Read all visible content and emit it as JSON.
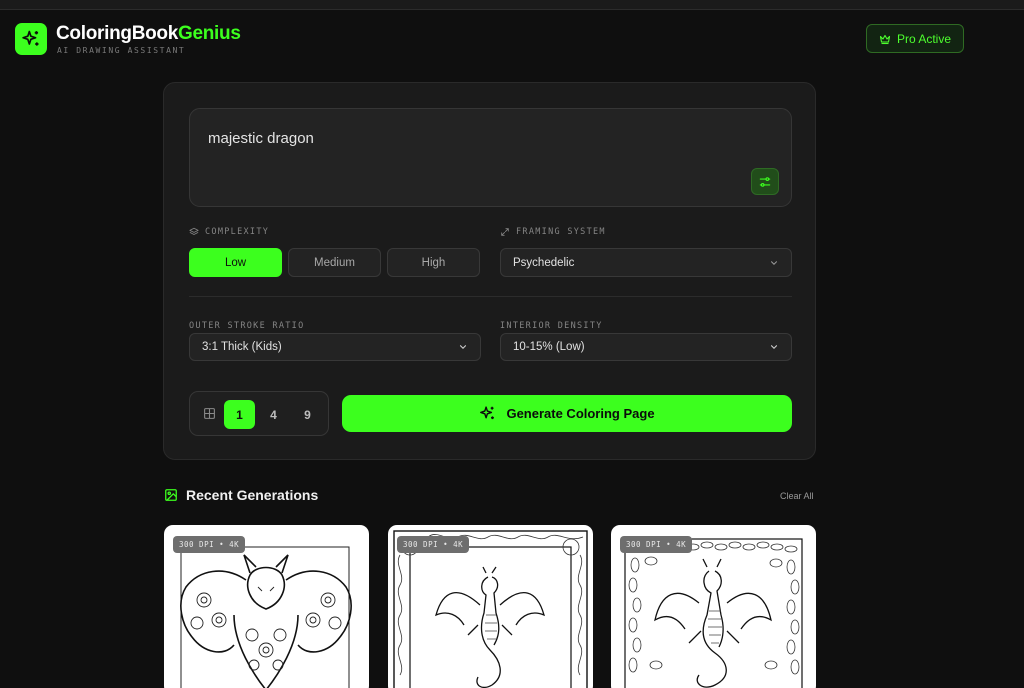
{
  "app": {
    "brand_part1": "ColoringBook",
    "brand_part2": "Genius",
    "tagline": "AI DRAWING ASSISTANT",
    "pro_badge": "Pro Active"
  },
  "prompt": {
    "value": "majestic dragon"
  },
  "complexity": {
    "label": "COMPLEXITY",
    "options": [
      "Low",
      "Medium",
      "High"
    ],
    "selected": "Low"
  },
  "framing": {
    "label": "FRAMING SYSTEM",
    "value": "Psychedelic"
  },
  "outer_stroke": {
    "label": "OUTER STROKE RATIO",
    "value": "3:1 Thick (Kids)"
  },
  "interior_density": {
    "label": "INTERIOR DENSITY",
    "value": "10-15% (Low)"
  },
  "count": {
    "options": [
      "1",
      "4",
      "9"
    ],
    "selected": "1"
  },
  "generate_label": "Generate Coloring Page",
  "recent": {
    "title": "Recent Generations",
    "clear_label": "Clear All",
    "items": [
      {
        "badge": "300 DPI • 4K"
      },
      {
        "badge": "300 DPI • 4K"
      },
      {
        "badge": "300 DPI • 4K"
      }
    ]
  },
  "colors": {
    "accent": "#3cff1e",
    "background": "#0f0f0f",
    "card": "#1b1b1b"
  },
  "icons": [
    "sparkles-icon",
    "crown-icon",
    "sliders-icon",
    "layers-icon",
    "expand-icon",
    "grid-icon",
    "image-icon",
    "chevron-down-icon"
  ]
}
